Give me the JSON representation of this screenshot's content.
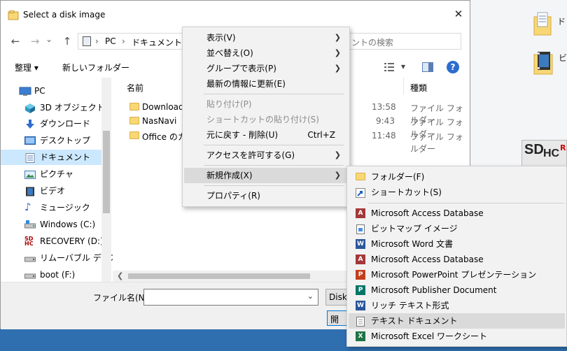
{
  "window": {
    "title": "Select a disk image",
    "close_glyph": "✕"
  },
  "nav": {
    "back": "←",
    "forward": "→",
    "dropdown": "⌄",
    "up": "↑",
    "breadcrumb": [
      "PC",
      "ドキュメント"
    ],
    "breadcrumb_sep": "›",
    "search_placeholder": "ントの検索"
  },
  "toolbar": {
    "organize": "整理 ▾",
    "new_folder": "新しいフォルダー",
    "view_glyph": "▾"
  },
  "sidebar": {
    "items": [
      {
        "label": "PC",
        "icon": "pc-icon"
      },
      {
        "label": "3D オブジェクト",
        "icon": "3d-objects-icon"
      },
      {
        "label": "ダウンロード",
        "icon": "download-icon"
      },
      {
        "label": "デスクトップ",
        "icon": "desktop-icon"
      },
      {
        "label": "ドキュメント",
        "icon": "documents-icon"
      },
      {
        "label": "ピクチャ",
        "icon": "pictures-icon"
      },
      {
        "label": "ビデオ",
        "icon": "videos-icon"
      },
      {
        "label": "ミュージック",
        "icon": "music-icon"
      },
      {
        "label": "Windows  (C:)",
        "icon": "drive-icon"
      },
      {
        "label": "RECOVERY (D:)",
        "icon": "sd-drive-icon"
      },
      {
        "label": "リムーバブル ディスク",
        "icon": "removable-drive-icon"
      },
      {
        "label": "boot (F:)",
        "icon": "drive-icon"
      }
    ]
  },
  "files": {
    "col_name": "名前",
    "col_type": "種類",
    "rows": [
      {
        "name": "Downloads",
        "time": "13:58",
        "type": "ファイル フォルダー"
      },
      {
        "name": "NasNavi",
        "time": "9:43",
        "type": "ファイル フォルダー"
      },
      {
        "name": "Office のカス",
        "time": "11:48",
        "type": "ファイル フォルダー"
      }
    ]
  },
  "bottom": {
    "filename_label": "ファイル名(N):",
    "filename_value": "",
    "filter_label": "Disk",
    "open_label": "開"
  },
  "context_menu": {
    "items": [
      {
        "label": "表示(V)",
        "arrow": "❯"
      },
      {
        "label": "並べ替え(O)",
        "arrow": "❯"
      },
      {
        "label": "グループで表示(P)",
        "arrow": "❯"
      },
      {
        "label": "最新の情報に更新(E)"
      },
      {
        "label": "貼り付け(P)",
        "disabled": true
      },
      {
        "label": "ショートカットの貼り付け(S)",
        "disabled": true
      },
      {
        "label": "元に戻す - 削除(U)",
        "shortcut": "Ctrl+Z"
      },
      {
        "label": "アクセスを許可する(G)",
        "arrow": "❯"
      },
      {
        "label": "新規作成(X)",
        "arrow": "❯"
      },
      {
        "label": "プロパティ(R)"
      }
    ]
  },
  "submenu": {
    "items": [
      {
        "label": "フォルダー(F)",
        "icon": "folder-icon"
      },
      {
        "label": "ショートカット(S)",
        "icon": "shortcut-icon"
      },
      {
        "label": "Microsoft Access Database",
        "icon": "access-icon",
        "badge": "A",
        "color": "#a4373a"
      },
      {
        "label": "ビットマップ イメージ",
        "icon": "bitmap-icon"
      },
      {
        "label": "Microsoft Word 文書",
        "icon": "word-icon",
        "badge": "W",
        "color": "#2b579a"
      },
      {
        "label": "Microsoft Access Database",
        "icon": "access-icon",
        "badge": "A",
        "color": "#a4373a"
      },
      {
        "label": "Microsoft PowerPoint プレゼンテーション",
        "icon": "powerpoint-icon",
        "badge": "P",
        "color": "#c43e1c"
      },
      {
        "label": "Microsoft Publisher Document",
        "icon": "publisher-icon",
        "badge": "P",
        "color": "#077568"
      },
      {
        "label": "リッチ テキスト形式",
        "icon": "rtf-icon",
        "badge": "W",
        "color": "#2b579a"
      },
      {
        "label": "テキスト ドキュメント",
        "icon": "text-doc-icon"
      },
      {
        "label": "Microsoft Excel ワークシート",
        "icon": "excel-icon",
        "badge": "X",
        "color": "#217346"
      }
    ]
  },
  "desktop": {
    "label_1": "ド",
    "label_2": "ビ",
    "sd_label": "SD",
    "sd_sub": "HC",
    "r_char": "R"
  }
}
